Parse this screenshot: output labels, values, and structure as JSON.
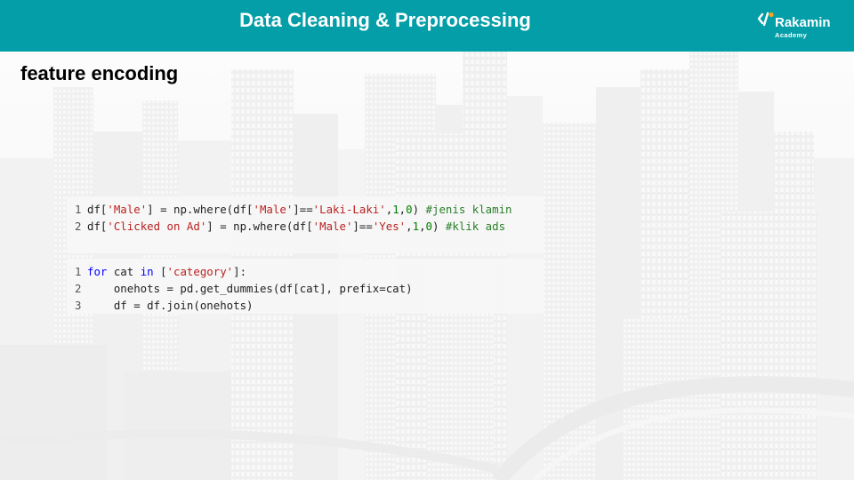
{
  "header": {
    "title": "Data Cleaning & Preprocessing",
    "brand": {
      "name": "Rakamin",
      "tagline": "Academy",
      "icon": "code-slash-icon"
    },
    "background_color": "#039ea8"
  },
  "page": {
    "title": "feature encoding"
  },
  "code_cells": [
    {
      "lines": [
        {
          "number": "1",
          "tokens": [
            {
              "t": "df[",
              "k": "p"
            },
            {
              "t": "'Male'",
              "k": "s"
            },
            {
              "t": "] = np.where(df[",
              "k": "p"
            },
            {
              "t": "'Male'",
              "k": "s"
            },
            {
              "t": "]==",
              "k": "p"
            },
            {
              "t": "'Laki-Laki'",
              "k": "s"
            },
            {
              "t": ",",
              "k": "p"
            },
            {
              "t": "1",
              "k": "n"
            },
            {
              "t": ",",
              "k": "p"
            },
            {
              "t": "0",
              "k": "n"
            },
            {
              "t": ") ",
              "k": "p"
            },
            {
              "t": "#jenis klamin",
              "k": "c"
            }
          ]
        },
        {
          "number": "2",
          "tokens": [
            {
              "t": "df[",
              "k": "p"
            },
            {
              "t": "'Clicked on Ad'",
              "k": "s"
            },
            {
              "t": "] = np.where(df[",
              "k": "p"
            },
            {
              "t": "'Male'",
              "k": "s"
            },
            {
              "t": "]==",
              "k": "p"
            },
            {
              "t": "'Yes'",
              "k": "s"
            },
            {
              "t": ",",
              "k": "p"
            },
            {
              "t": "1",
              "k": "n"
            },
            {
              "t": ",",
              "k": "p"
            },
            {
              "t": "0",
              "k": "n"
            },
            {
              "t": ") ",
              "k": "p"
            },
            {
              "t": "#klik ads",
              "k": "c"
            }
          ]
        }
      ]
    },
    {
      "lines": [
        {
          "number": "1",
          "tokens": [
            {
              "t": "for",
              "k": "k"
            },
            {
              "t": " cat ",
              "k": "p"
            },
            {
              "t": "in",
              "k": "k"
            },
            {
              "t": " [",
              "k": "p"
            },
            {
              "t": "'category'",
              "k": "s"
            },
            {
              "t": "]:",
              "k": "p"
            }
          ]
        },
        {
          "number": "2",
          "tokens": [
            {
              "t": "    onehots = pd.get_dummies(df[cat], prefix=cat)",
              "k": "p"
            }
          ]
        },
        {
          "number": "3",
          "tokens": [
            {
              "t": "    df = df.join(onehots)",
              "k": "p"
            }
          ]
        }
      ]
    }
  ]
}
